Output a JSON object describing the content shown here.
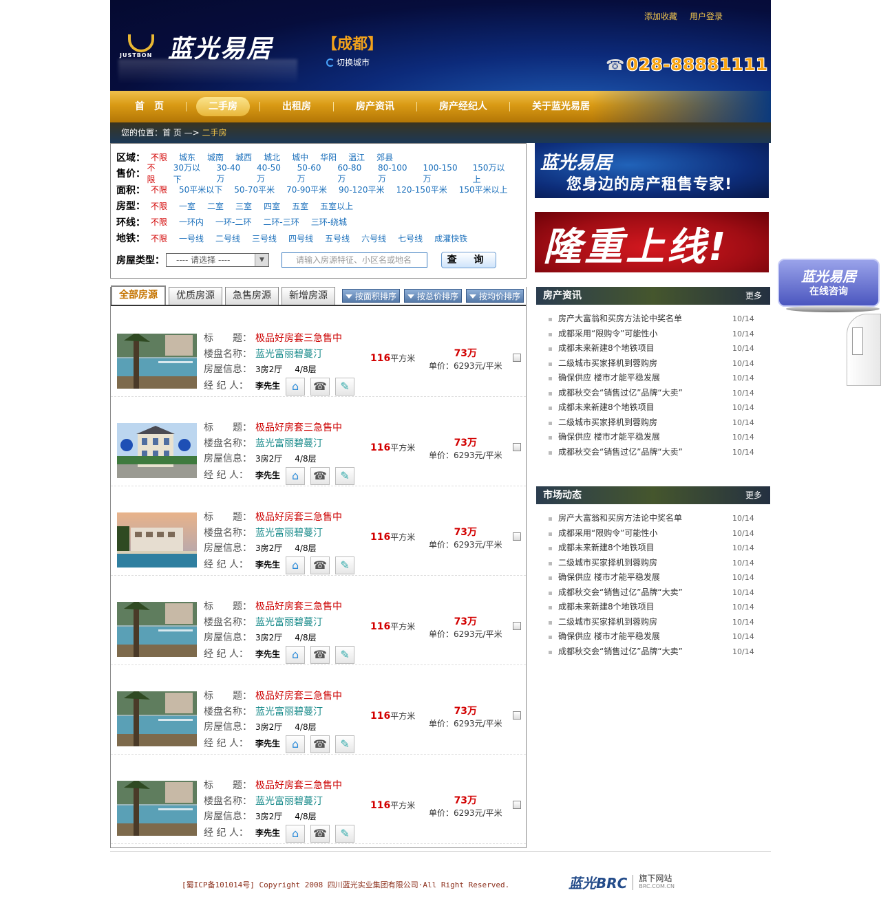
{
  "header": {
    "toplinks": [
      "添加收藏",
      "用户登录"
    ],
    "logo_en": "JUSTBON",
    "logo_cn": "蓝光易居",
    "city": "【成都】",
    "switch_city": "切换城市",
    "phone": "028-88881111"
  },
  "nav": {
    "items": [
      "首　页",
      "二手房",
      "出租房",
      "房产资讯",
      "房产经纪人",
      "关于蓝光易居"
    ],
    "active_index": 1
  },
  "breadcrumb": {
    "prefix": "您的位置：首 页 —> ",
    "current": "二手房"
  },
  "filter": {
    "rows": [
      {
        "label": "区域：",
        "items": [
          "不限",
          "城东",
          "城南",
          "城西",
          "城北",
          "城中",
          "华阳",
          "温江",
          "郊县"
        ]
      },
      {
        "label": "售价：",
        "items": [
          "不限",
          "30万以下",
          "30-40万",
          "40-50万",
          "50-60万",
          "60-80万",
          "80-100万",
          "100-150万",
          "150万以上"
        ]
      },
      {
        "label": "面积：",
        "items": [
          "不限",
          "50平米以下",
          "50-70平米",
          "70-90平米",
          "90-120平米",
          "120-150平米",
          "150平米以上"
        ]
      },
      {
        "label": "房型：",
        "items": [
          "不限",
          "一室",
          "二室",
          "三室",
          "四室",
          "五室",
          "五室以上"
        ]
      },
      {
        "label": "环线：",
        "items": [
          "不限",
          "一环内",
          "一环-二环",
          "二环-三环",
          "三环-绕城"
        ]
      },
      {
        "label": "地铁：",
        "items": [
          "不限",
          "一号线",
          "二号线",
          "三号线",
          "四号线",
          "五号线",
          "六号线",
          "七号线",
          "成灌快铁"
        ]
      }
    ],
    "type_label": "房屋类型：",
    "type_select": "---- 请选择 ----",
    "search_placeholder": "请输入房源特征、小区名或地名",
    "search_button": "查 询"
  },
  "banners": {
    "banner1_logo": "蓝光易居",
    "banner1_slogan": "您身边的房产租售专家!",
    "banner2_text": "隆重上线!"
  },
  "listing": {
    "tabs": [
      "全部房源",
      "优质房源",
      "急售房源",
      "新增房源"
    ],
    "sort_buttons": [
      "按面积排序",
      "按总价排序",
      "按均价排序"
    ],
    "field_labels": {
      "title": "标　　题：",
      "estate": "楼盘名称：",
      "info": "房屋信息：",
      "agent": "经 纪 人："
    },
    "items": [
      {
        "title": "极品好房套三急售中",
        "estate": "蓝光富丽碧蔓汀",
        "rooms": "3房2厅",
        "floor": "4/8层",
        "agent": "李先生",
        "area": "116",
        "area_unit": "平方米",
        "price": "73万",
        "unit_price_label": "单价：",
        "unit_price": "6293元/平米",
        "photo": "pool"
      },
      {
        "title": "极品好房套三急售中",
        "estate": "蓝光富丽碧蔓汀",
        "rooms": "3房2厅",
        "floor": "4/8层",
        "agent": "李先生",
        "area": "116",
        "area_unit": "平方米",
        "price": "73万",
        "unit_price_label": "单价：",
        "unit_price": "6293元/平米",
        "photo": "building"
      },
      {
        "title": "极品好房套三急售中",
        "estate": "蓝光富丽碧蔓汀",
        "rooms": "3房2厅",
        "floor": "4/8层",
        "agent": "李先生",
        "area": "116",
        "area_unit": "平方米",
        "price": "73万",
        "unit_price_label": "单价：",
        "unit_price": "6293元/平米",
        "photo": "villa"
      },
      {
        "title": "极品好房套三急售中",
        "estate": "蓝光富丽碧蔓汀",
        "rooms": "3房2厅",
        "floor": "4/8层",
        "agent": "李先生",
        "area": "116",
        "area_unit": "平方米",
        "price": "73万",
        "unit_price_label": "单价：",
        "unit_price": "6293元/平米",
        "photo": "pool"
      },
      {
        "title": "极品好房套三急售中",
        "estate": "蓝光富丽碧蔓汀",
        "rooms": "3房2厅",
        "floor": "4/8层",
        "agent": "李先生",
        "area": "116",
        "area_unit": "平方米",
        "price": "73万",
        "unit_price_label": "单价：",
        "unit_price": "6293元/平米",
        "photo": "pool"
      },
      {
        "title": "极品好房套三急售中",
        "estate": "蓝光富丽碧蔓汀",
        "rooms": "3房2厅",
        "floor": "4/8层",
        "agent": "李先生",
        "area": "116",
        "area_unit": "平方米",
        "price": "73万",
        "unit_price_label": "单价：",
        "unit_price": "6293元/平米",
        "photo": "pool"
      }
    ]
  },
  "news": {
    "title": "房产资讯",
    "more": "更多",
    "items": [
      {
        "text": "房产大富翁和买房方法论中奖名单",
        "date": "10/14"
      },
      {
        "text": "成都采用“限购令”可能性小",
        "date": "10/14"
      },
      {
        "text": "成都未来新建8个地铁项目",
        "date": "10/14"
      },
      {
        "text": "二级城市买家择机到蓉购房",
        "date": "10/14"
      },
      {
        "text": "确保供应 楼市才能平稳发展",
        "date": "10/14"
      },
      {
        "text": "成都秋交会“销售过亿”品牌“大卖”",
        "date": "10/14"
      },
      {
        "text": "成都未来新建8个地铁项目",
        "date": "10/14"
      },
      {
        "text": "二级城市买家择机到蓉购房",
        "date": "10/14"
      },
      {
        "text": "确保供应 楼市才能平稳发展",
        "date": "10/14"
      },
      {
        "text": "成都秋交会“销售过亿”品牌“大卖”",
        "date": "10/14"
      }
    ]
  },
  "market": {
    "title": "市场动态",
    "more": "更多",
    "items": [
      {
        "text": "房产大富翁和买房方法论中奖名单",
        "date": "10/14"
      },
      {
        "text": "成都采用“限购令”可能性小",
        "date": "10/14"
      },
      {
        "text": "成都未来新建8个地铁项目",
        "date": "10/14"
      },
      {
        "text": "二级城市买家择机到蓉购房",
        "date": "10/14"
      },
      {
        "text": "确保供应 楼市才能平稳发展",
        "date": "10/14"
      },
      {
        "text": "成都秋交会“销售过亿”品牌“大卖”",
        "date": "10/14"
      },
      {
        "text": "成都未来新建8个地铁项目",
        "date": "10/14"
      },
      {
        "text": "二级城市买家择机到蓉购房",
        "date": "10/14"
      },
      {
        "text": "确保供应 楼市才能平稳发展",
        "date": "10/14"
      },
      {
        "text": "成都秋交会“销售过亿”品牌“大卖”",
        "date": "10/14"
      }
    ]
  },
  "float_consult": {
    "logo": "蓝光易居",
    "label": "在线咨询"
  },
  "footer": {
    "copyright": "[蜀ICP备101014号]  Copyright 2008  四川蓝光实业集团有限公司·All Right Reserved.",
    "brand": "蓝光BRC",
    "brand_sub": "旗下网站",
    "brand_url": "BRC.COM.CN"
  }
}
